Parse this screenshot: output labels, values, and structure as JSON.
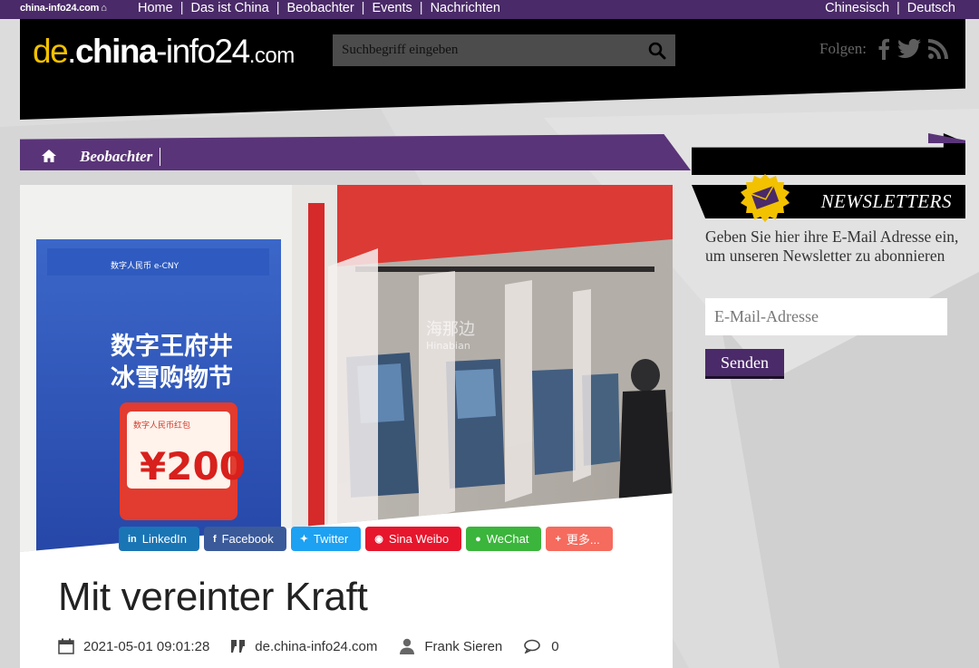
{
  "topbar": {
    "mini_logo": "china-info24.com",
    "nav": [
      "Home",
      "Das ist China",
      "Beobachter",
      "Events",
      "Nachrichten"
    ],
    "languages": [
      "Chinesisch",
      "Deutsch"
    ]
  },
  "header": {
    "logo": {
      "de": "de",
      "dot": ".",
      "china": "china",
      "dash": "-",
      "info": "info24",
      "com": ".com"
    },
    "search_placeholder": "Suchbegriff eingeben",
    "follow_label": "Folgen:"
  },
  "breadcrumb": {
    "section": "Beobachter"
  },
  "image_text": {
    "poster_line1": "数字王府井",
    "poster_line2": "冰雪购物节",
    "poster_amount": "¥200",
    "poster_small": "数字人民币红包",
    "poster_ecny": "数字人民币 e-CNY",
    "watermark_cn": "海那边",
    "watermark_en": "Hinabian"
  },
  "share": [
    {
      "label": "LinkedIn",
      "icon": "in",
      "color": "#1a75b5"
    },
    {
      "label": "Facebook",
      "icon": "f",
      "color": "#3b5a9a"
    },
    {
      "label": "Twitter",
      "icon": "✦",
      "color": "#1da1f2"
    },
    {
      "label": "Sina Weibo",
      "icon": "◉",
      "color": "#e6162d"
    },
    {
      "label": "WeChat",
      "icon": "●",
      "color": "#3bb53b"
    },
    {
      "label": "更多...",
      "icon": "+",
      "color": "#f56b5e"
    }
  ],
  "article": {
    "title": "Mit vereinter Kraft",
    "date": "2021-05-01 09:01:28",
    "source": "de.china-info24.com",
    "author": "Frank Sieren",
    "comments": "0"
  },
  "sidebar": {
    "newsletter_title": "NEWSLETTERS",
    "newsletter_text": "Geben Sie hier ihre E-Mail Adresse ein, um unseren Newsletter zu abonnieren",
    "email_placeholder": "E-Mail-Adresse",
    "submit_label": "Senden"
  },
  "colors": {
    "purple": "#4a2a68",
    "brand_yellow": "#f2c100"
  }
}
